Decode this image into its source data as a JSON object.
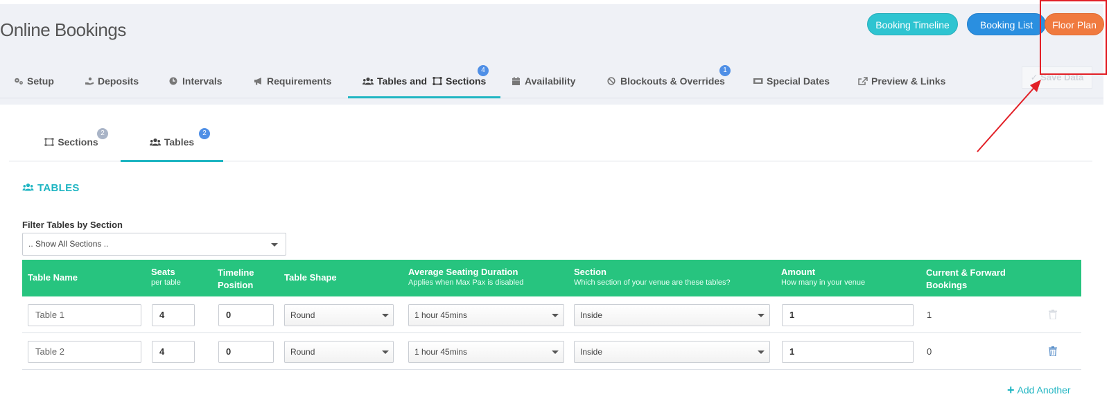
{
  "page": {
    "title": "Online Bookings"
  },
  "header_buttons": {
    "booking_timeline": "Booking Timeline",
    "booking_list": "Booking List",
    "floor_plan": "Floor Plan"
  },
  "save_data": "Save Data",
  "nav": {
    "tabs": [
      {
        "label": "Setup",
        "icon": "gears-icon"
      },
      {
        "label": "Deposits",
        "icon": "hand-coin-icon"
      },
      {
        "label": "Intervals",
        "icon": "clock-icon"
      },
      {
        "label": "Requirements",
        "icon": "megaphone-icon"
      },
      {
        "label": "Tables and",
        "label2": "Sections",
        "icon": "users-icon",
        "icon2": "object-group-icon",
        "badge": "4",
        "active": true
      },
      {
        "label": "Availability",
        "icon": "calendar-icon"
      },
      {
        "label": "Blockouts & Overrides",
        "icon": "ban-icon",
        "badge": "1"
      },
      {
        "label": "Special Dates",
        "icon": "ticket-icon"
      },
      {
        "label": "Preview & Links",
        "icon": "external-link-icon"
      }
    ]
  },
  "subtabs": [
    {
      "label": "Sections",
      "badge": "2",
      "icon": "object-group-icon"
    },
    {
      "label": "Tables",
      "badge": "2",
      "icon": "users-icon",
      "active": true
    }
  ],
  "section_heading": "TABLES",
  "filter": {
    "label": "Filter Tables by Section",
    "value": ".. Show All Sections .."
  },
  "table": {
    "headers": [
      {
        "title": "Table Name",
        "sub": ""
      },
      {
        "title": "Seats",
        "sub": "per table"
      },
      {
        "title": "Timeline Position",
        "sub": ""
      },
      {
        "title": "Table Shape",
        "sub": ""
      },
      {
        "title": "Average Seating Duration",
        "sub": "Applies when Max Pax is disabled"
      },
      {
        "title": "Section",
        "sub": "Which section of your venue are these tables?"
      },
      {
        "title": "Amount",
        "sub": "How many in your venue"
      },
      {
        "title": "Current & Forward Bookings",
        "sub": ""
      }
    ],
    "rows": [
      {
        "name": "Table 1",
        "seats": "4",
        "position": "0",
        "shape": "Round",
        "duration": "1 hour 45mins",
        "section": "Inside",
        "amount": "1",
        "bookings": "1"
      },
      {
        "name": "Table 2",
        "seats": "4",
        "position": "0",
        "shape": "Round",
        "duration": "1 hour 45mins",
        "section": "Inside",
        "amount": "1",
        "bookings": "0"
      }
    ]
  },
  "add_another": "Add Another",
  "colors": {
    "teal": "#1fb5c2",
    "table_header_green": "#27c47f",
    "timeline_button": "#2ec4d1",
    "list_button": "#2a8fe0",
    "floor_plan_button": "#f07a3f",
    "badge_blue": "#4f8fe6",
    "annotation_red": "#e22027"
  }
}
